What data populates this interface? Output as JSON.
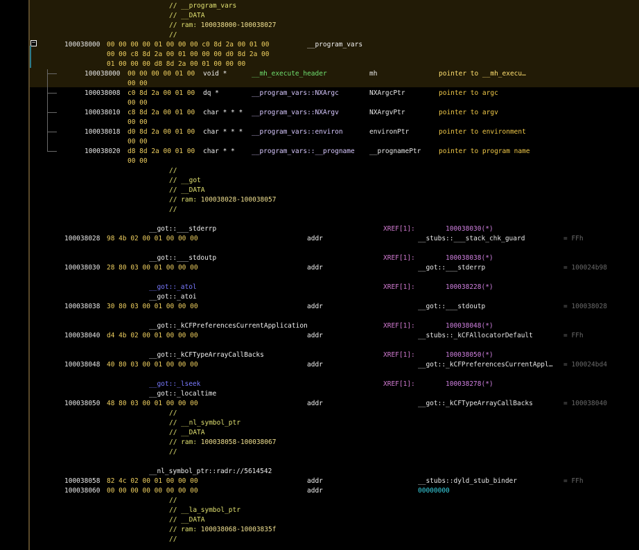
{
  "program_vars": {
    "comment_title": "// __program_vars",
    "comment_section": "// __DATA",
    "comment_ram_prefix": "// ram: ",
    "comment_ram_range": "100038000-100038027",
    "comment_blank": "//",
    "struct_addr": "100038000",
    "struct_bytes_1": "00 00 00 00 01 00 00 00 c0 8d 2a 00 01 00",
    "struct_bytes_2": "00 00 c8 8d 2a 00 01 00 00 00 d0 8d 2a 00",
    "struct_bytes_3": "01 00 00 00 d8 8d 2a 00 01 00 00 00",
    "struct_label": "__program_vars",
    "fields": [
      {
        "addr": "100038000",
        "bytes": "00 00 00 00 01 00",
        "bytes2": "00 00",
        "type": "void *",
        "sym": "__mh_execute_header",
        "name": "mh",
        "desc": "pointer to __mh_execu…"
      },
      {
        "addr": "100038008",
        "bytes": "c0 8d 2a 00 01 00",
        "bytes2": "00 00",
        "type": "dq *",
        "sym": "__program_vars::NXArgc",
        "name": "NXArgcPtr",
        "desc": "pointer to argc"
      },
      {
        "addr": "100038010",
        "bytes": "c8 8d 2a 00 01 00",
        "bytes2": "00 00",
        "type": "char * * *",
        "sym": "__program_vars::NXArgv",
        "name": "NXArgvPtr",
        "desc": "pointer to argv"
      },
      {
        "addr": "100038018",
        "bytes": "d0 8d 2a 00 01 00",
        "bytes2": "00 00",
        "type": "char * * *",
        "sym": "__program_vars::environ",
        "name": "environPtr",
        "desc": "pointer to environment"
      },
      {
        "addr": "100038020",
        "bytes": "d8 8d 2a 00 01 00",
        "bytes2": "00 00",
        "type": "char * *",
        "sym": "__program_vars::__progname",
        "name": "__prognamePtr",
        "desc": "pointer to program name"
      }
    ]
  },
  "got": {
    "comment_blank": "//",
    "comment_title": "// __got",
    "comment_section": "// __DATA",
    "comment_ram_prefix": "// ram: ",
    "comment_ram_range": "100038028-100038057",
    "entries": [
      {
        "label": "__got::___stderrp",
        "xref": "XREF[1]:",
        "xref_addr": "100038030(*)",
        "addr": "100038028",
        "bytes": "98 4b 02 00 01 00 00 00",
        "mnemonic": "addr",
        "operand": "__stubs::___stack_chk_guard",
        "eq": "= FFh"
      },
      {
        "label": "__got::___stdoutp",
        "xref": "XREF[1]:",
        "xref_addr": "100038038(*)",
        "addr": "100038030",
        "bytes": "28 80 03 00 01 00 00 00",
        "mnemonic": "addr",
        "operand": "__got::___stderrp",
        "eq": "= 100024b98"
      },
      {
        "label_alt": "__got::_atol",
        "label": "__got::_atoi",
        "xref": "XREF[1]:",
        "xref_addr": "100038228(*)",
        "addr": "100038038",
        "bytes": "30 80 03 00 01 00 00 00",
        "mnemonic": "addr",
        "operand": "__got::___stdoutp",
        "eq": "= 100038028"
      },
      {
        "label": "__got::_kCFPreferencesCurrentApplication",
        "xref": "XREF[1]:",
        "xref_addr": "100038048(*)",
        "addr": "100038040",
        "bytes": "d4 4b 02 00 01 00 00 00",
        "mnemonic": "addr",
        "operand": "__stubs::_kCFAllocatorDefault",
        "eq": "= FFh"
      },
      {
        "label": "__got::_kCFTypeArrayCallBacks",
        "xref": "XREF[1]:",
        "xref_addr": "100038050(*)",
        "addr": "100038048",
        "bytes": "40 80 03 00 01 00 00 00",
        "mnemonic": "addr",
        "operand": "__got::_kCFPreferencesCurrentAppl…",
        "eq": "= 100024bd4"
      },
      {
        "label_alt": "__got::_lseek",
        "label": "__got::_localtime",
        "xref": "XREF[1]:",
        "xref_addr": "100038278(*)",
        "addr": "100038050",
        "bytes": "48 80 03 00 01 00 00 00",
        "mnemonic": "addr",
        "operand": "__got::_kCFTypeArrayCallBacks",
        "eq": "= 100038040"
      }
    ]
  },
  "nl_symbol_ptr": {
    "comment_blank": "//",
    "comment_title": "// __nl_symbol_ptr",
    "comment_section": "// __DATA",
    "comment_ram_prefix": "// ram: ",
    "comment_ram_range": "100038058-100038067",
    "label": "__nl_symbol_ptr::radr://5614542",
    "rows": [
      {
        "addr": "100038058",
        "bytes": "82 4c 02 00 01 00 00 00",
        "mnemonic": "addr",
        "operand": "__stubs::dyld_stub_binder",
        "eq": "= FFh"
      },
      {
        "addr": "100038060",
        "bytes": "00 00 00 00 00 00 00 00",
        "mnemonic": "addr",
        "operand": "00000000",
        "eq": ""
      }
    ]
  },
  "la_symbol_ptr": {
    "comment_blank": "//",
    "comment_title": "// __la_symbol_ptr",
    "comment_section": "// __DATA",
    "comment_ram_prefix": "// ram: ",
    "comment_ram_range": "100038068-10003835f"
  }
}
